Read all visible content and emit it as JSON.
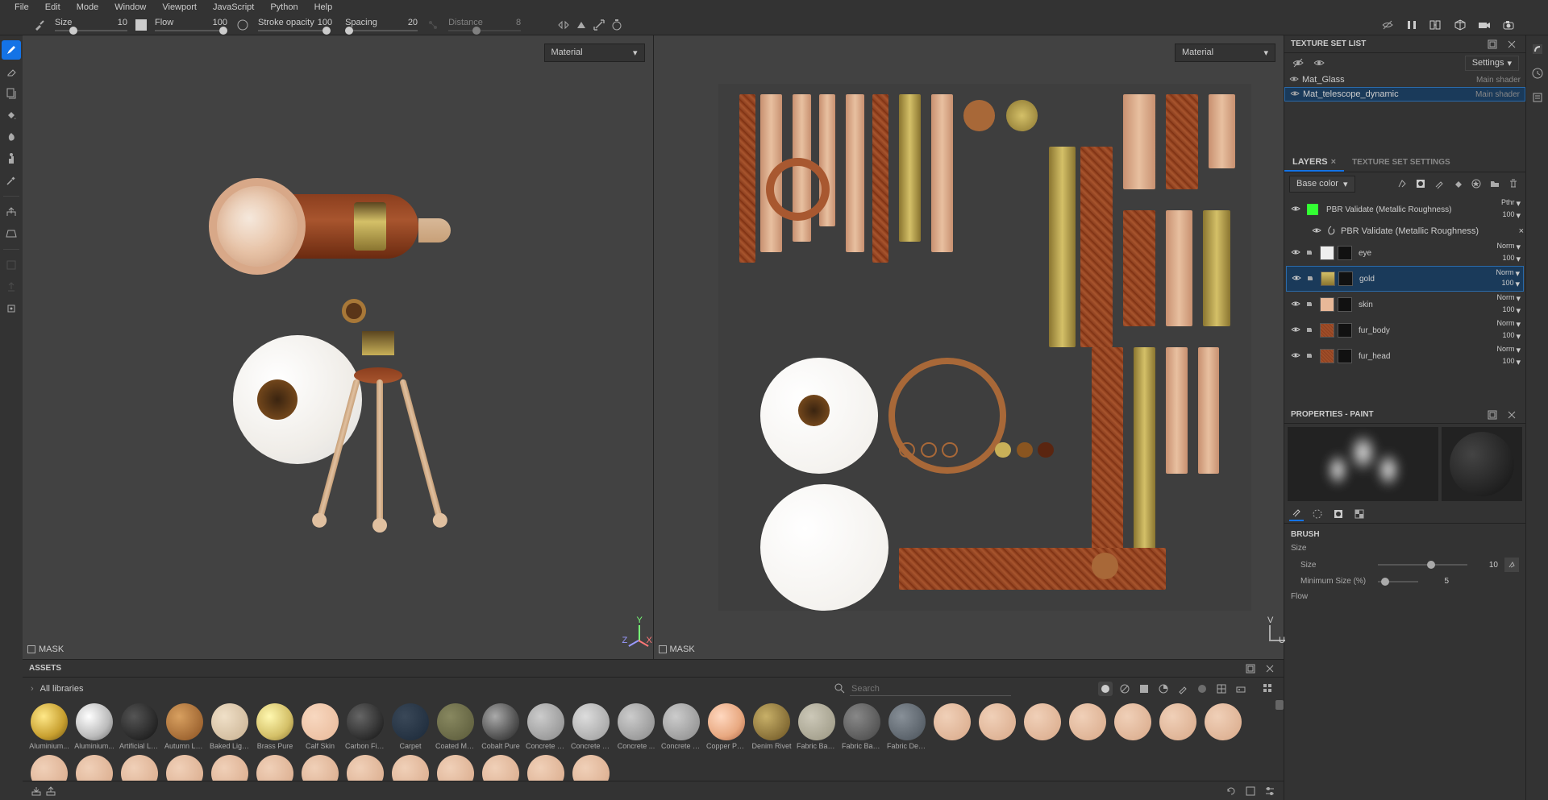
{
  "menu": [
    "File",
    "Edit",
    "Mode",
    "Window",
    "Viewport",
    "JavaScript",
    "Python",
    "Help"
  ],
  "toolbar": {
    "size_label": "Size",
    "size_value": "10",
    "flow_label": "Flow",
    "flow_value": "100",
    "stroke_label": "Stroke opacity",
    "stroke_value": "100",
    "spacing_label": "Spacing",
    "spacing_value": "20",
    "distance_label": "Distance",
    "distance_value": "8"
  },
  "viewport": {
    "dropdown_3d": "Material",
    "dropdown_2d": "Material",
    "mask_label_3d": "MASK",
    "mask_label_2d": "MASK",
    "axis_x": "X",
    "axis_y": "Y",
    "axis_z": "Z",
    "axis_u": "U",
    "axis_v": "V"
  },
  "textureSet": {
    "panel_title": "TEXTURE SET LIST",
    "settings_label": "Settings",
    "items": [
      {
        "name": "Mat_Glass",
        "shader": "Main shader",
        "selected": false
      },
      {
        "name": "Mat_telescope_dynamic",
        "shader": "Main shader",
        "selected": true
      }
    ]
  },
  "layersPanel": {
    "tab_layers": "LAYERS",
    "tab_settings": "TEXTURE SET SETTINGS",
    "channel": "Base color",
    "layers": [
      {
        "name": "PBR Validate (Metallic Roughness)",
        "blend": "Pthr",
        "opacity": "100",
        "type": "filter",
        "sub": "PBR Validate (Metallic Roughness)"
      },
      {
        "name": "eye",
        "blend": "Norm",
        "opacity": "100",
        "type": "folder"
      },
      {
        "name": "gold",
        "blend": "Norm",
        "opacity": "100",
        "type": "folder",
        "selected": true
      },
      {
        "name": "skin",
        "blend": "Norm",
        "opacity": "100",
        "type": "folder"
      },
      {
        "name": "fur_body",
        "blend": "Norm",
        "opacity": "100",
        "type": "folder"
      },
      {
        "name": "fur_head",
        "blend": "Norm",
        "opacity": "100",
        "type": "folder"
      }
    ]
  },
  "properties": {
    "panel_title": "PROPERTIES - PAINT",
    "brush_section": "BRUSH",
    "size_group": "Size",
    "size_label": "Size",
    "size_value": "10",
    "min_size_label": "Minimum Size (%)",
    "min_size_value": "5",
    "flow_group": "Flow"
  },
  "assets": {
    "panel_title": "ASSETS",
    "all_libs": "All libraries",
    "search_placeholder": "Search",
    "items": [
      {
        "name": "Aluminium...",
        "bg": "radial-gradient(circle at 35% 35%, #ffe888, #c8a030 60%, #6a5010)"
      },
      {
        "name": "Aluminium...",
        "bg": "radial-gradient(circle at 35% 35%, #fff, #bbb 60%, #666)"
      },
      {
        "name": "Artificial Le...",
        "bg": "radial-gradient(circle at 35% 35%, #555, #111)"
      },
      {
        "name": "Autumn Le...",
        "bg": "radial-gradient(circle at 35% 35%, #d8a060, #8a5020)"
      },
      {
        "name": "Baked Ligh...",
        "bg": "radial-gradient(circle at 35% 35%, #f0e0c8, #c8b090)"
      },
      {
        "name": "Brass Pure",
        "bg": "radial-gradient(circle at 35% 35%, #fff8b0, #d4c068 60%, #8a7530)"
      },
      {
        "name": "Calf Skin",
        "bg": "radial-gradient(circle at 35% 35%, #f8d8c0, #e8b898)"
      },
      {
        "name": "Carbon Fib...",
        "bg": "radial-gradient(circle at 35% 35%, #666, #111)"
      },
      {
        "name": "Carpet",
        "bg": "radial-gradient(circle at 35% 35%, #3a4858, #1a2838)"
      },
      {
        "name": "Coated Me...",
        "bg": "radial-gradient(circle at 35% 35%, #888860, #585838)"
      },
      {
        "name": "Cobalt Pure",
        "bg": "radial-gradient(circle at 35% 35%, #aaa, #555 60%, #222)"
      },
      {
        "name": "Concrete B...",
        "bg": "radial-gradient(circle at 35% 35%, #ccc, #888)"
      },
      {
        "name": "Concrete C...",
        "bg": "radial-gradient(circle at 35% 35%, #ddd, #999)"
      },
      {
        "name": "Concrete ...",
        "bg": "radial-gradient(circle at 35% 35%, #ccc, #888)"
      },
      {
        "name": "Concrete S...",
        "bg": "radial-gradient(circle at 35% 35%, #ccc, #888)"
      },
      {
        "name": "Copper Pure",
        "bg": "radial-gradient(circle at 35% 35%, #ffd8c0, #e8a880 60%, #a86040)"
      },
      {
        "name": "Denim Rivet",
        "bg": "radial-gradient(circle at 35% 35%, #c8b068, #685020)"
      },
      {
        "name": "Fabric Bam...",
        "bg": "radial-gradient(circle at 35% 35%, #ccc8b8, #989480)"
      },
      {
        "name": "Fabric Bas...",
        "bg": "radial-gradient(circle at 35% 35%, #888, #444)"
      },
      {
        "name": "Fabric Den...",
        "bg": "radial-gradient(circle at 35% 35%, #889098, #485058)"
      }
    ]
  }
}
